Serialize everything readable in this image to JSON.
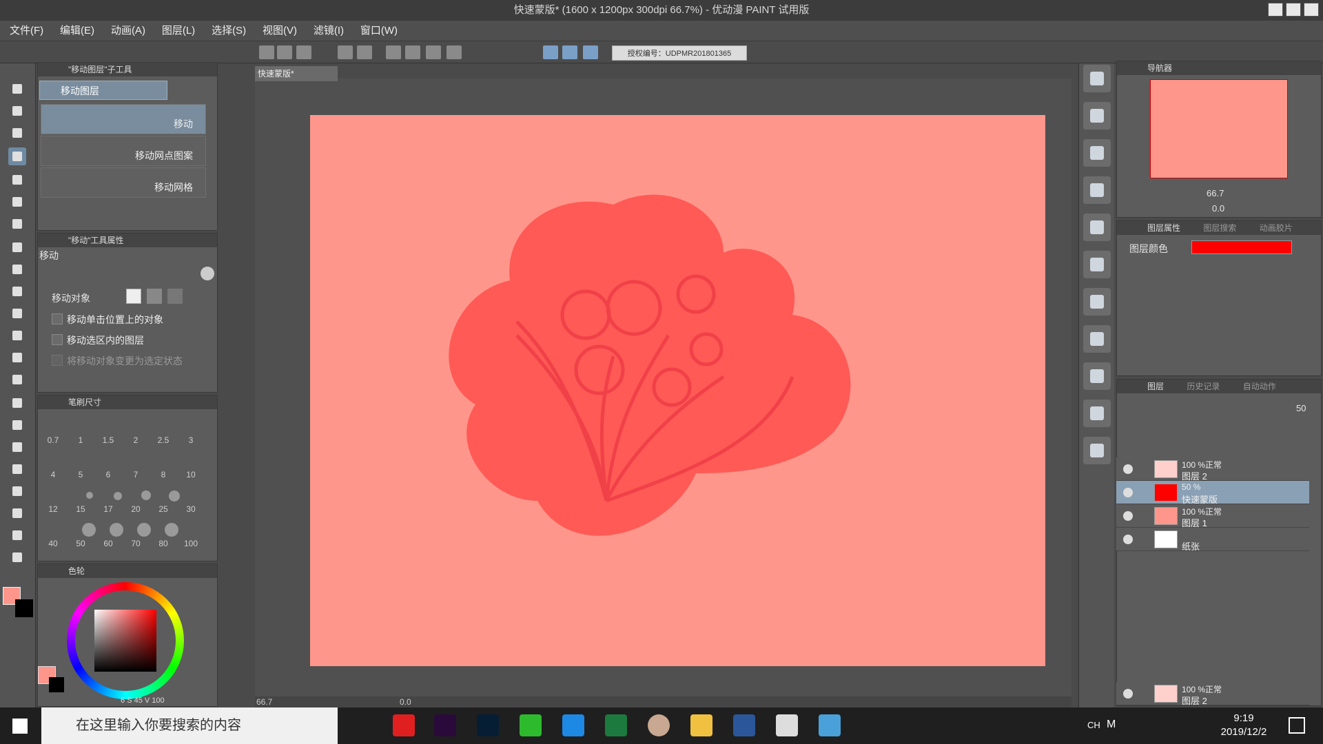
{
  "window": {
    "title": "快速蒙版* (1600 x 1200px 300dpi 66.7%) - 优动漫 PAINT 试用版"
  },
  "menu": [
    "文件(F)",
    "编辑(E)",
    "动画(A)",
    "图层(L)",
    "选择(S)",
    "视图(V)",
    "滤镜(I)",
    "窗口(W)"
  ],
  "toolbar": {
    "license": "授权编号：UDPMR201801365"
  },
  "subtool": {
    "header": "\"移动图层\"子工具",
    "group": "移动图层",
    "items": [
      "移动",
      "移动网点图案",
      "移动网格"
    ]
  },
  "toolprop": {
    "header": "\"移动\"工具属性",
    "name": "移动",
    "target_label": "移动对象",
    "options": [
      "移动单击位置上的对象",
      "移动选区内的图层",
      "将移动对象变更为选定状态"
    ]
  },
  "brushsize": {
    "header": "笔刷尺寸",
    "sizes": [
      "0.7",
      "1",
      "1.5",
      "2",
      "2.5",
      "3",
      "4",
      "5",
      "6",
      "7",
      "8",
      "10",
      "12",
      "15",
      "17",
      "20",
      "25",
      "30",
      "40",
      "50",
      "60",
      "70",
      "80",
      "100"
    ]
  },
  "colorwheel": {
    "header": "色轮",
    "readout_s": "S",
    "value_h": "6",
    "value_s": "45",
    "readout_v": "V",
    "value_v": "100"
  },
  "canvas": {
    "tab": "快速蒙版*",
    "bg_color": "#ff968c",
    "mask_color": "#ff5a55",
    "zoom": "66.7",
    "rotation": "0.0"
  },
  "navigator": {
    "header": "导航器",
    "zoom": "66.7",
    "rotation": "0.0"
  },
  "layerprop": {
    "header": "图层属性",
    "tab2": "图层搜索",
    "tab3": "动画胶片",
    "color_label": "图层颜色",
    "color": "#ff0000"
  },
  "layers": {
    "header": "图层",
    "tab2": "历史记录",
    "tab3": "自动动作",
    "opacity": "50",
    "items": [
      {
        "pct": "100 %正常",
        "name": "图层 2"
      },
      {
        "pct": "50 %",
        "name": "快速蒙版"
      },
      {
        "pct": "100 %正常",
        "name": "图层 1"
      },
      {
        "pct": "",
        "name": "纸张"
      }
    ],
    "footer": {
      "pct": "100 %正常",
      "name": "图层 2"
    }
  },
  "taskbar": {
    "search": "在这里输入你要搜索的内容",
    "ime": "CH",
    "ime2": "M",
    "time": "9:19",
    "date": "2019/12/2"
  }
}
